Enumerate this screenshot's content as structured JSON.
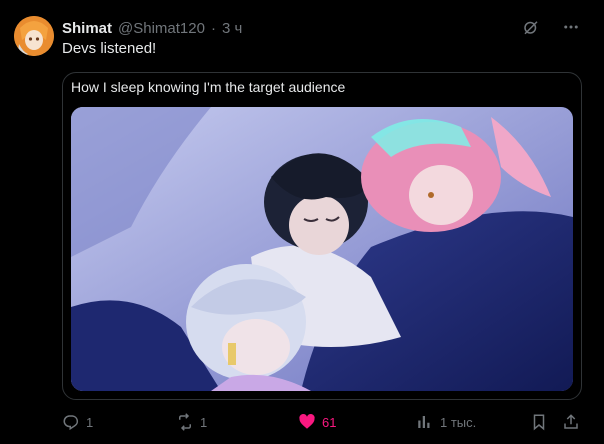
{
  "post": {
    "author_name": "Shimat",
    "author_handle": "@Shimat120",
    "separator": "·",
    "time": "3 ч",
    "text": "Devs listened!",
    "media": {
      "caption": "How I sleep knowing I'm the target audience"
    },
    "actions": {
      "replies": "1",
      "reposts": "1",
      "likes": "61",
      "views": "1 тыс."
    }
  },
  "colors": {
    "like": "#f91880",
    "muted": "#71767b",
    "text": "#e7e9ea",
    "border": "#2f3336"
  },
  "icons": [
    "grok-icon",
    "more-icon",
    "reply-icon",
    "repost-icon",
    "heart-icon",
    "views-icon",
    "bookmark-icon",
    "share-icon"
  ]
}
